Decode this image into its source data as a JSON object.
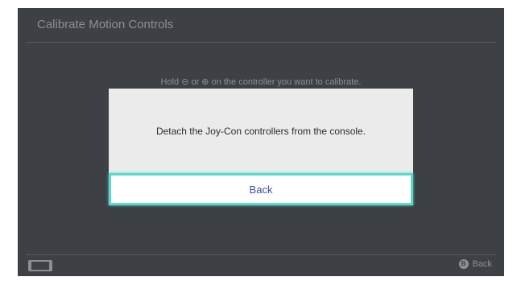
{
  "screen": {
    "title": "Calibrate Motion Controls",
    "instruction": "Hold ⊖ or ⊕ on the controller you want to calibrate.",
    "footer": {
      "back_icon": "B",
      "back_label": "Back"
    }
  },
  "dialog": {
    "message": "Detach the Joy-Con controllers from the console.",
    "button_label": "Back"
  },
  "colors": {
    "background": "#3d4045",
    "dialog": "#ebebeb",
    "focus_outline": "#5ad9cc",
    "button_text": "#3b4ba8"
  }
}
